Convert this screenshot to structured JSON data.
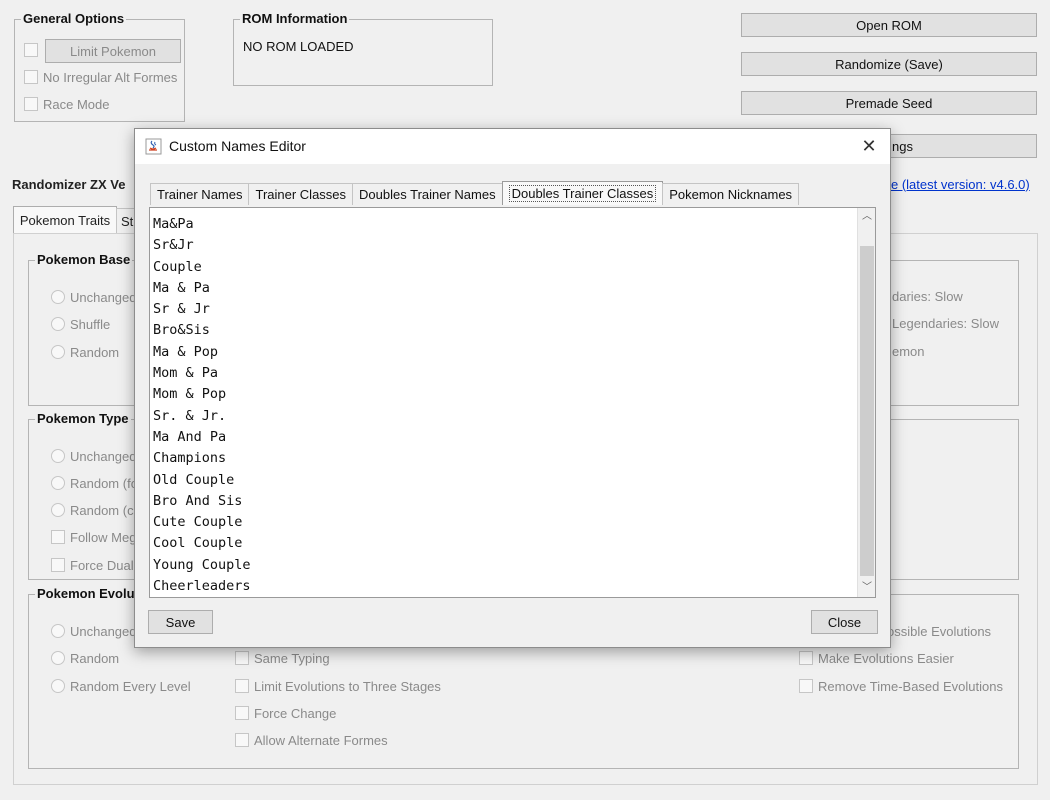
{
  "general_options": {
    "title": "General Options",
    "limit_pokemon_label": "Limit Pokemon",
    "no_irregular_alt_formes": "No Irregular Alt Formes",
    "race_mode": "Race Mode"
  },
  "rom_info": {
    "title": "ROM Information",
    "status": "NO ROM LOADED"
  },
  "actions": {
    "open_rom": "Open ROM",
    "randomize_save": "Randomize (Save)",
    "premade_seed": "Premade Seed",
    "settings_fragment": "ngs"
  },
  "version": {
    "label_fragment": "Randomizer ZX Ve",
    "link_fragment": "e (latest version: v4.6.0)"
  },
  "main_tabs": {
    "pokemon_traits": "Pokemon Traits",
    "next_fragment": "St"
  },
  "base_stats": {
    "title_fragment": "Pokemon Base",
    "options": [
      "Unchanged",
      "Shuffle",
      "Random"
    ],
    "right_fragments": [
      "daries: Slow",
      "Legendaries: Slow",
      "emon"
    ]
  },
  "types": {
    "title_fragment": "Pokemon Type",
    "options": [
      "Unchanged",
      "Random (fo",
      "Random (co"
    ],
    "checks": [
      "Follow Meg",
      "Force Dual"
    ]
  },
  "evolutions": {
    "title_fragment": "Pokemon Evolu",
    "options": [
      "Unchanged",
      "Random",
      "Random Every Level"
    ],
    "middle_checks": [
      "Same Typing",
      "Limit Evolutions to Three Stages",
      "Force Change",
      "Allow Alternate Formes"
    ],
    "right_checks": [
      "ossible Evolutions",
      "Make Evolutions Easier",
      "Remove Time-Based Evolutions"
    ]
  },
  "dialog": {
    "title": "Custom Names Editor",
    "close_glyph": "✕",
    "tabs": [
      "Trainer Names",
      "Trainer Classes",
      "Doubles Trainer Names",
      "Doubles Trainer Classes",
      "Pokemon Nicknames"
    ],
    "active_tab": "Doubles Trainer Classes",
    "lines": [
      "Ma&Pa",
      "Sr&Jr",
      "Couple",
      "Ma & Pa",
      "Sr & Jr",
      "Bro&Sis",
      "Ma & Pop",
      "Mom & Pa",
      "Mom & Pop",
      "Sr. & Jr.",
      "Ma And Pa",
      "Champions",
      "Old Couple",
      "Bro And Sis",
      "Cute Couple",
      "Cool Couple",
      "Young Couple",
      "Cheerleaders"
    ],
    "save_label": "Save",
    "close_label": "Close",
    "scroll_up_glyph": "︿",
    "scroll_down_glyph": "﹀"
  }
}
